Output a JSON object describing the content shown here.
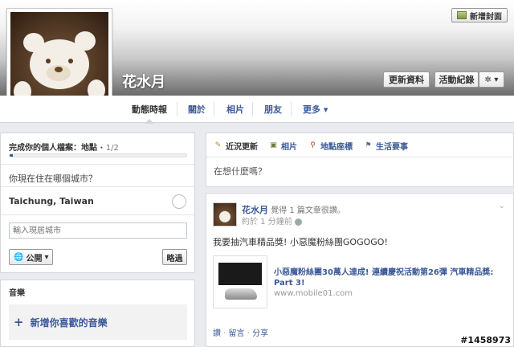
{
  "header": {
    "add_cover_label": "新增封面",
    "profile_name": "花水月",
    "update_info_label": "更新資料",
    "activity_log_label": "活動紀錄",
    "settings_glyph": "✲ ▾"
  },
  "tabs": [
    {
      "label": "動態時報",
      "active": true
    },
    {
      "label": "關於"
    },
    {
      "label": "相片"
    },
    {
      "label": "朋友"
    },
    {
      "label": "更多 ▾"
    }
  ],
  "profile_completion": {
    "title": "完成你的個人檔案：地點 ·",
    "progress_text": "1/2",
    "progress_fraction": 0.5,
    "question": "你現在住在哪個城市？",
    "suggested_city": "Taichung, Taiwan",
    "city_placeholder": "輸入現居城市",
    "privacy_label": "公開",
    "skip_label": "略過"
  },
  "music": {
    "heading": "音樂",
    "add_label": "新增你喜歡的音樂"
  },
  "composer": {
    "tabs": [
      "近況更新",
      "相片",
      "地點座標",
      "生活要事"
    ],
    "placeholder": "在想什麼嗎？"
  },
  "post": {
    "author": "花水月",
    "action": "覺得 1 篇文章很讚。",
    "time": "約於 1 分鐘前",
    "text": "我要抽汽車精品獎! 小惡魔粉絲團GOGOGO!",
    "link_title": "小惡魔粉絲團30萬人達成! 連續慶祝活動第26彈 汽車精品獎: Part 3!",
    "link_url": "www.mobile01.com",
    "action_like": "讚",
    "action_comment": "留言",
    "action_share": "分享"
  },
  "watermark": "#1458973",
  "colors": {
    "link": "#3b5998",
    "page_bg": "#e9ebee"
  }
}
